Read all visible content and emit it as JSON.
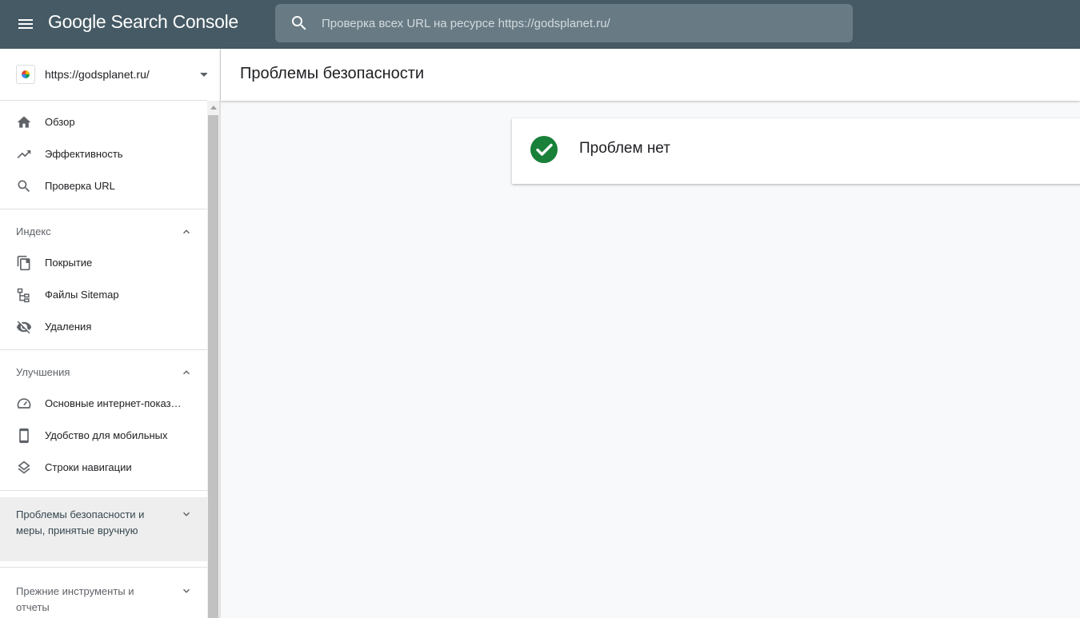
{
  "app": {
    "logo_text": "Google Search Console",
    "colors": {
      "topbar": "#455a64",
      "success": "#188038",
      "active_bg": "#eeeeee"
    }
  },
  "search": {
    "placeholder": "Проверка всех URL на ресурсе https://godsplanet.ru/",
    "icon": "search-icon"
  },
  "property": {
    "url": "https://godsplanet.ru/",
    "icon": "favicon"
  },
  "sidebar": {
    "main_items": [
      {
        "label": "Обзор",
        "icon": "home-icon"
      },
      {
        "label": "Эффективность",
        "icon": "trending-up-icon"
      },
      {
        "label": "Проверка URL",
        "icon": "search-icon"
      }
    ],
    "index": {
      "title": "Индекс",
      "items": [
        {
          "label": "Покрытие",
          "icon": "copy-pages-icon"
        },
        {
          "label": "Файлы Sitemap",
          "icon": "sitemap-icon"
        },
        {
          "label": "Удаления",
          "icon": "visibility-off-icon"
        }
      ]
    },
    "enhancements": {
      "title": "Улучшения",
      "items": [
        {
          "label": "Основные интернет-показ…",
          "icon": "speed-gauge-icon"
        },
        {
          "label": "Удобство для мобильных",
          "icon": "smartphone-icon"
        },
        {
          "label": "Строки навигации",
          "icon": "layers-icon"
        }
      ]
    },
    "security": {
      "title": "Проблемы безопасности и меры, принятые вручную"
    },
    "legacy": {
      "title": "Прежние инструменты и отчеты"
    }
  },
  "main": {
    "title": "Проблемы безопасности",
    "status": {
      "icon": "check-circle-icon",
      "message": "Проблем нет"
    }
  }
}
